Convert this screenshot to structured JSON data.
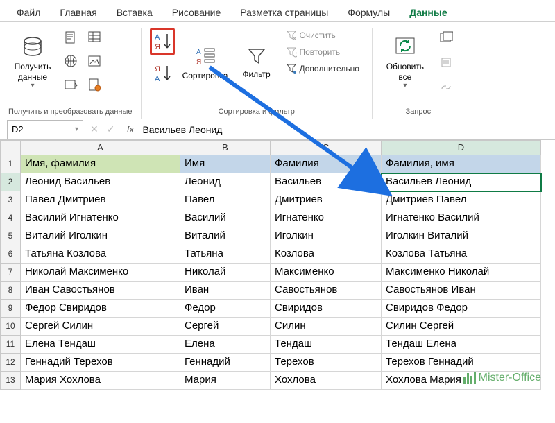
{
  "menu": [
    "Файл",
    "Главная",
    "Вставка",
    "Рисование",
    "Разметка страницы",
    "Формулы",
    "Данные"
  ],
  "menu_active_idx": 6,
  "ribbon": {
    "group1_label": "Получить и преобразовать данные",
    "get_data": "Получить\nданные",
    "group2_label": "Сортировка и фильтр",
    "sort": "Сортировка",
    "filter": "Фильтр",
    "clear": "Очистить",
    "reapply": "Повторить",
    "advanced": "Дополнительно",
    "group3_label": "Запрос",
    "refresh": "Обновить\nвсе"
  },
  "namebox": "D2",
  "formula": "Васильев Леонид",
  "columns": [
    "A",
    "B",
    "C",
    "D"
  ],
  "selected_col": 3,
  "selected_row": 2,
  "headers": [
    "Имя, фамилия",
    "Имя",
    "Фамилия",
    "Фамилия, имя"
  ],
  "rows": [
    [
      "Леонид Васильев",
      "Леонид",
      "Васильев",
      "Васильев Леонид"
    ],
    [
      "Павел Дмитриев",
      "Павел",
      "Дмитриев",
      "Дмитриев Павел"
    ],
    [
      "Василий Игнатенко",
      "Василий",
      "Игнатенко",
      "Игнатенко Василий"
    ],
    [
      "Виталий Иголкин",
      "Виталий",
      "Иголкин",
      "Иголкин Виталий"
    ],
    [
      "Татьяна Козлова",
      "Татьяна",
      "Козлова",
      "Козлова Татьяна"
    ],
    [
      "Николай Максименко",
      "Николай",
      "Максименко",
      "Максименко Николай"
    ],
    [
      "Иван Савостьянов",
      "Иван",
      "Савостьянов",
      "Савостьянов Иван"
    ],
    [
      "Федор Свиридов",
      "Федор",
      "Свиридов",
      "Свиридов Федор"
    ],
    [
      "Сергей Силин",
      "Сергей",
      "Силин",
      "Силин Сергей"
    ],
    [
      "Елена Тендаш",
      "Елена",
      "Тендаш",
      "Тендаш Елена"
    ],
    [
      "Геннадий Терехов",
      "Геннадий",
      "Терехов",
      "Терехов Геннадий"
    ],
    [
      "Мария Хохлова",
      "Мария",
      "Хохлова",
      "Хохлова Мария"
    ]
  ],
  "watermark": "Mister-Office"
}
